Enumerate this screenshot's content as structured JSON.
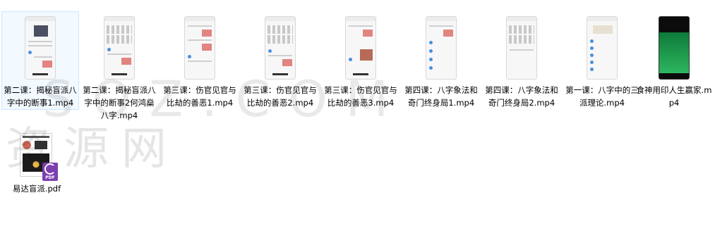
{
  "files": [
    {
      "name": "第二课：揭秘盲派八字中的断事1.mp4",
      "type": "video",
      "thumb": "phone-portrait",
      "selected": true
    },
    {
      "name": "第二课：揭秘盲派八字中的断事2何鸿燊八字.mp4",
      "type": "video",
      "thumb": "phone-calendar"
    },
    {
      "name": "第三课：伤官见官与比劫的善恶1.mp4",
      "type": "video",
      "thumb": "phone-table"
    },
    {
      "name": "第三课：伤官见官与比劫的善恶2.mp4",
      "type": "video",
      "thumb": "phone-calendar"
    },
    {
      "name": "第三课：伤官见官与比劫的善恶3.mp4",
      "type": "video",
      "thumb": "phone-table-photo"
    },
    {
      "name": "第四课：八字象法和奇门终身局1.mp4",
      "type": "video",
      "thumb": "phone-list"
    },
    {
      "name": "第四课：八字象法和奇门终身局2.mp4",
      "type": "video",
      "thumb": "phone-calendar-blank"
    },
    {
      "name": "第一课：八字中的三派理论.mp4",
      "type": "video",
      "thumb": "phone-bazi"
    },
    {
      "name": "食神用印人生赢家.mp4",
      "type": "video",
      "thumb": "phone-dark-green"
    },
    {
      "name": "易达盲派.pdf",
      "type": "pdf",
      "thumb": "pdf-document"
    }
  ],
  "pdf_badge_text": "PDF"
}
